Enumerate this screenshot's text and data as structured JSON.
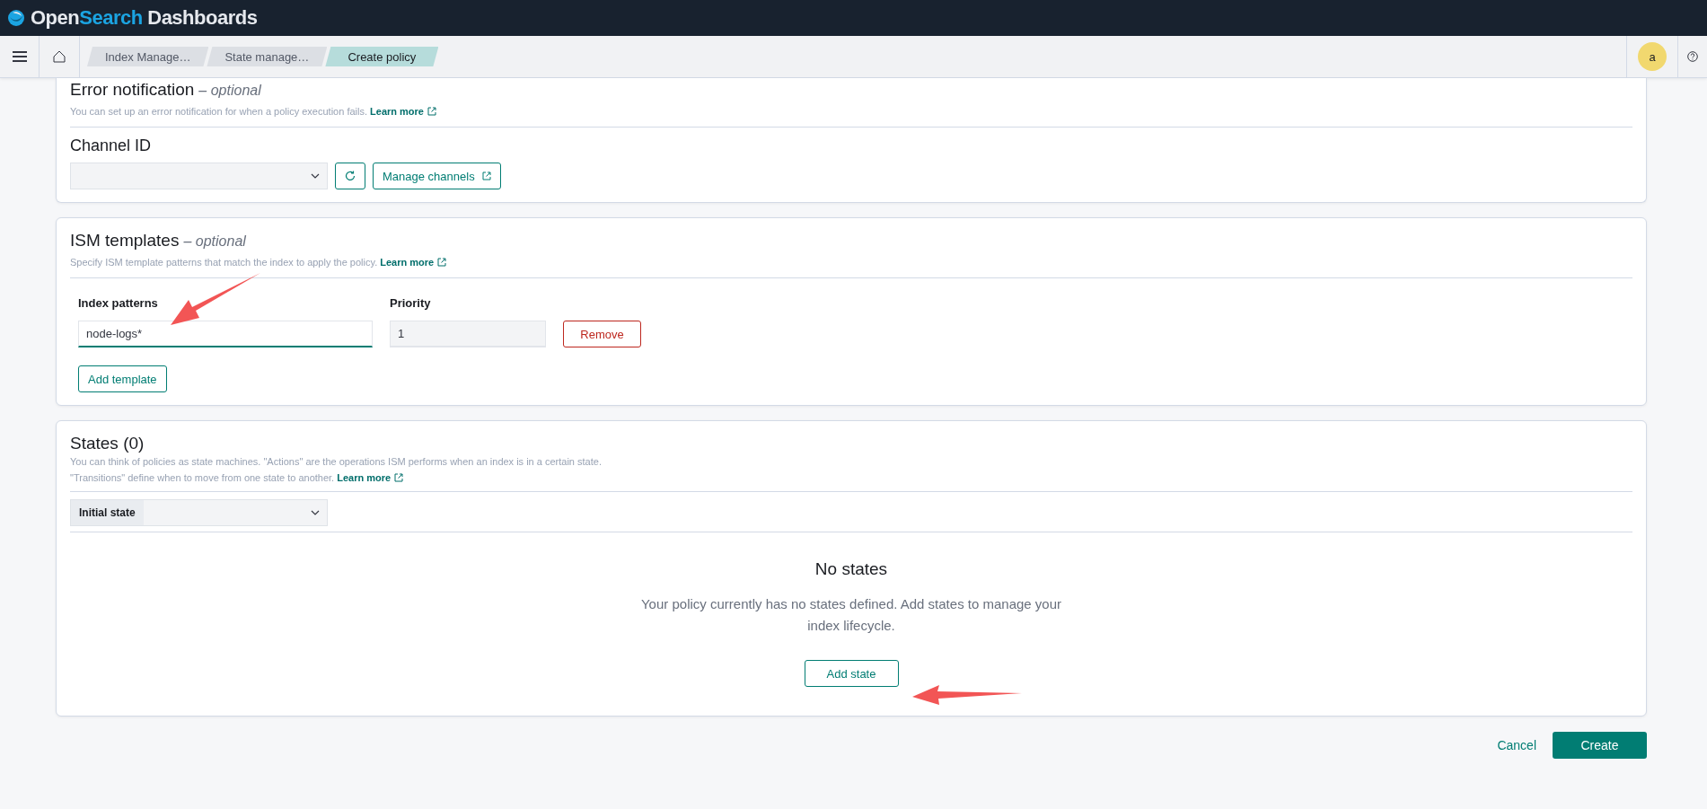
{
  "header": {
    "brand_first": "Open",
    "brand_second": "Search",
    "brand_third": "Dashboards"
  },
  "breadcrumbs": [
    {
      "label": "Index Manage…",
      "selected": false
    },
    {
      "label": "State manage…",
      "selected": false
    },
    {
      "label": "Create policy",
      "selected": true
    }
  ],
  "user_avatar": "a",
  "error_notification": {
    "title": "Error notification",
    "optional": "– optional",
    "description": "You can set up an error notification for when a policy execution fails.",
    "link": "Learn more",
    "channel_label": "Channel ID",
    "manage_button": "Manage channels"
  },
  "ism_templates": {
    "title": "ISM templates",
    "optional": "– optional",
    "description": "Specify ISM template patterns that match the index to apply the policy.",
    "link": "Learn more",
    "index_label": "Index patterns",
    "priority_label": "Priority",
    "rows": [
      {
        "index_pattern": "node-logs*",
        "priority": "1",
        "remove": "Remove"
      }
    ],
    "add_button": "Add template"
  },
  "states": {
    "title": "States (0)",
    "description_1": "You can think of policies as state machines. \"Actions\" are the operations ISM performs when an index is in a certain state.",
    "description_2": "\"Transitions\" define when to move from one state to another.",
    "link": "Learn more",
    "initial_label": "Initial state",
    "empty_title": "No states",
    "empty_text": "Your policy currently has no states defined. Add states to manage your index lifecycle.",
    "add_button": "Add state"
  },
  "footer": {
    "cancel": "Cancel",
    "create": "Create"
  }
}
